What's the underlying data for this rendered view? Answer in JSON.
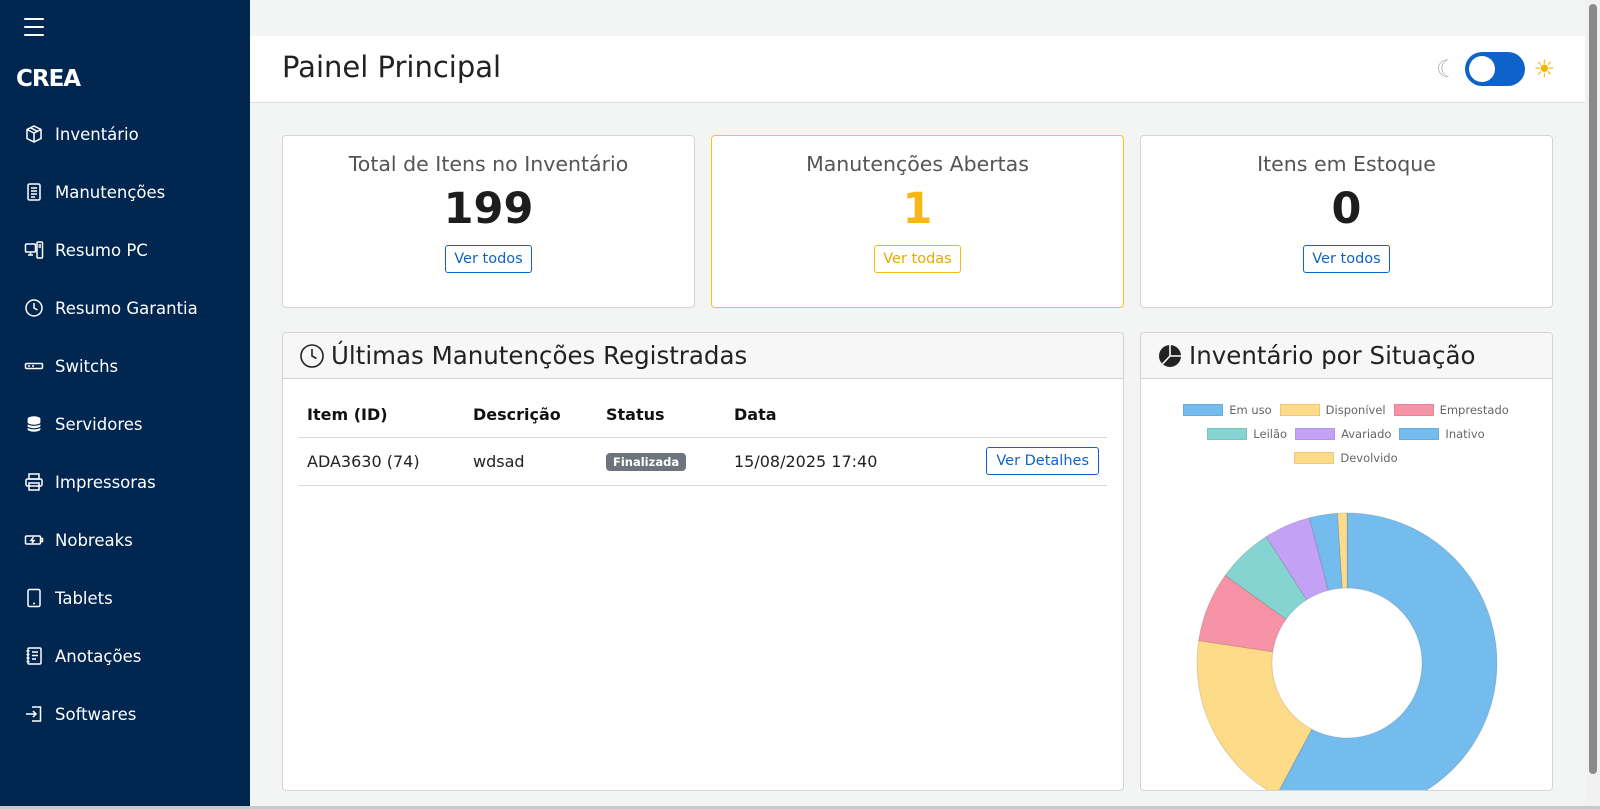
{
  "app": {
    "brand": "CREA"
  },
  "sidebar": {
    "items": [
      {
        "label": "Inventário",
        "icon": "box-icon"
      },
      {
        "label": "Manutenções",
        "icon": "document-icon"
      },
      {
        "label": "Resumo PC",
        "icon": "computer-icon"
      },
      {
        "label": "Resumo Garantia",
        "icon": "clock-icon"
      },
      {
        "label": "Switchs",
        "icon": "switch-icon"
      },
      {
        "label": "Servidores",
        "icon": "database-icon"
      },
      {
        "label": "Impressoras",
        "icon": "printer-icon"
      },
      {
        "label": "Nobreaks",
        "icon": "battery-icon"
      },
      {
        "label": "Tablets",
        "icon": "tablet-icon"
      },
      {
        "label": "Anotações",
        "icon": "notes-icon"
      },
      {
        "label": "Softwares",
        "icon": "login-icon"
      }
    ]
  },
  "header": {
    "title": "Painel Principal"
  },
  "stats": [
    {
      "title": "Total de Itens no Inventário",
      "value": "199",
      "button": "Ver todos"
    },
    {
      "title": "Manutenções Abertas",
      "value": "1",
      "button": "Ver todas"
    },
    {
      "title": "Itens em Estoque",
      "value": "0",
      "button": "Ver todos"
    }
  ],
  "maintenance": {
    "title": "Últimas Manutenções Registradas",
    "columns": [
      "Item (ID)",
      "Descrição",
      "Status",
      "Data"
    ],
    "rows": [
      {
        "item": "ADA3630 (74)",
        "description": "wdsad",
        "status": "Finalizada",
        "date": "15/08/2025 17:40",
        "action": "Ver Detalhes"
      }
    ]
  },
  "inventory_chart": {
    "title": "Inventário por Situação"
  },
  "chart_data": {
    "type": "pie",
    "variant": "doughnut",
    "categories": [
      "Em uso",
      "Disponível",
      "Emprestado",
      "Leilão",
      "Avariado",
      "Inativo",
      "Devolvido"
    ],
    "values": [
      115,
      39,
      15,
      12,
      10,
      6,
      2
    ],
    "colors": [
      "#74bcee",
      "#fddb88",
      "#f793a6",
      "#86d4d1",
      "#c3a2f5",
      "#74bcee",
      "#fddb88"
    ],
    "legend_position": "top"
  },
  "colors": {
    "sidebar_bg": "#012650",
    "primary": "#0d63c9",
    "warning": "#f7b815",
    "badge": "#6c757d"
  }
}
